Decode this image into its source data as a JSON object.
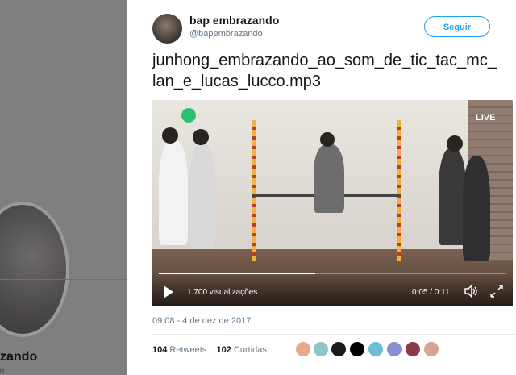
{
  "background_profile": {
    "name": "zando",
    "sub": "0"
  },
  "tweet": {
    "display_name": "bap embrazando",
    "handle": "@bapembrazando",
    "follow_label": "Seguir",
    "text": "junhong_embrazando_ao_som_de_tic_tac_mc_\nlan_e_lucas_lucco.mp3",
    "timestamp": "09:08 - 4 de dez de 2017",
    "retweets_count": "104",
    "retweets_label": "Retweets",
    "likes_count": "102",
    "likes_label": "Curtidas"
  },
  "video": {
    "live_badge": "LIVE",
    "views": "1.700 visualizações",
    "time": "0:05 / 0:11",
    "progress": 0.45
  },
  "icons": {
    "play": "play-icon",
    "volume": "volume-icon",
    "fullscreen": "fullscreen-icon"
  },
  "colors": {
    "accent": "#1da1f2",
    "text": "#14171a",
    "secondary": "#657786"
  }
}
